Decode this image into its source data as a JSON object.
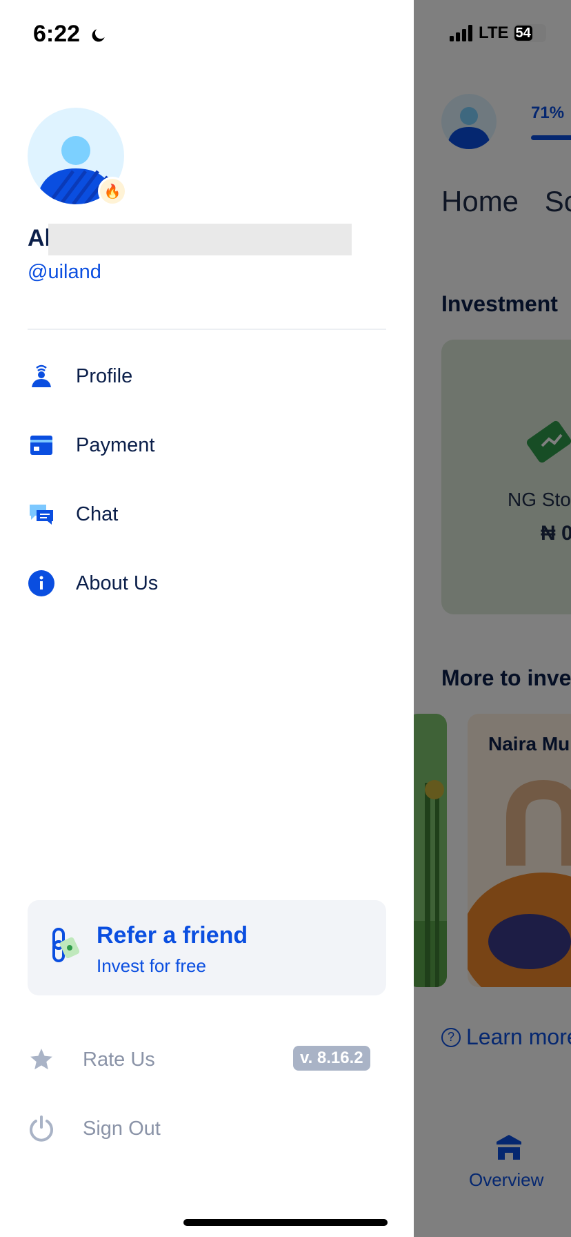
{
  "status_bar": {
    "time": "6:22",
    "network": "LTE",
    "battery": "54"
  },
  "drawer": {
    "user": {
      "name_visible": "Al",
      "handle": "@uiland"
    },
    "menu": [
      {
        "label": "Profile",
        "icon": "profile-icon"
      },
      {
        "label": "Payment",
        "icon": "card-icon"
      },
      {
        "label": "Chat",
        "icon": "chat-icon"
      },
      {
        "label": "About Us",
        "icon": "info-icon"
      }
    ],
    "refer": {
      "title": "Refer a friend",
      "subtitle": "Invest for free"
    },
    "footer": {
      "rate_label": "Rate Us",
      "version": "v. 8.16.2",
      "signout_label": "Sign Out"
    }
  },
  "background_app": {
    "progress_text": "71%",
    "tabs": [
      "Home",
      "Sc"
    ],
    "section1": "Investment",
    "card_label": "NG Sto",
    "card_value": "₦ 0",
    "section2": "More to inve",
    "tile_title": "Naira Mu",
    "learn_more": "Learn more",
    "nav_overview": "Overview"
  },
  "colors": {
    "accent": "#0a4ee0",
    "text_dark": "#0b1f4a",
    "muted": "#8a93a7"
  }
}
